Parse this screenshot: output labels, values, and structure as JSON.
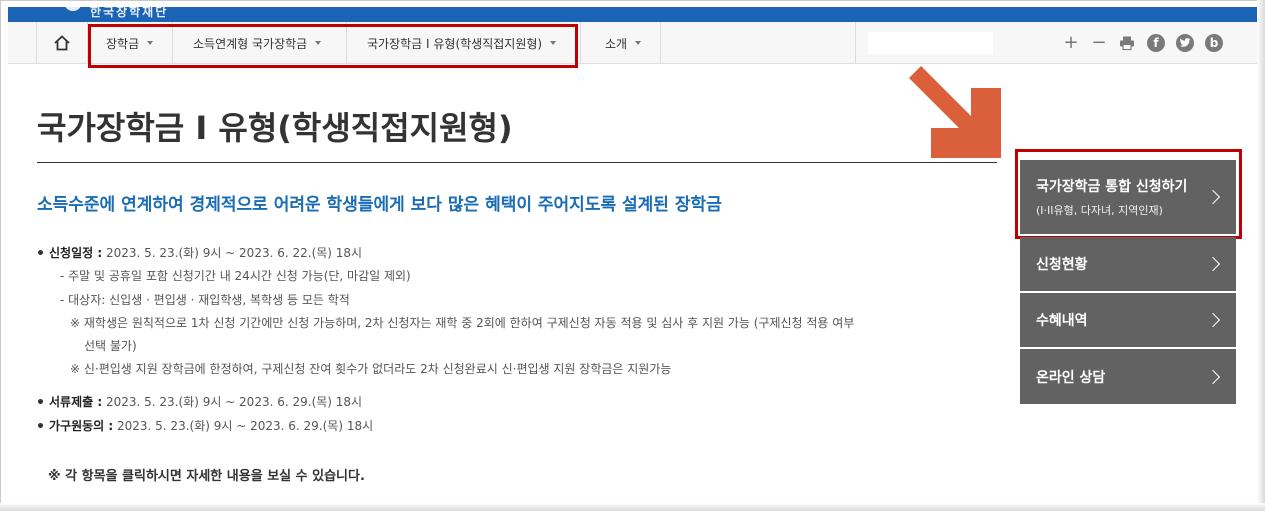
{
  "header": {
    "logo_text": "한국장학재단"
  },
  "nav": {
    "home_icon": "home-icon",
    "items": [
      {
        "label": "장학금"
      },
      {
        "label": "소득연계형 국가장학금"
      },
      {
        "label": "국가장학금 I 유형(학생직접지원형)"
      },
      {
        "label": "소개"
      }
    ],
    "tools": [
      "plus-icon",
      "minus-icon",
      "print-icon",
      "facebook-icon",
      "twitter-icon",
      "blog-icon"
    ],
    "tool_glyphs": {
      "plus": "+",
      "minus": "−",
      "facebook": "f",
      "blog": "b"
    }
  },
  "page": {
    "title": "국가장학금 I 유형(학생직접지원형)",
    "subtitle": "소득수준에 연계하여 경제적으로 어려운 학생들에게 보다 많은 혜택이 주어지도록 설계된 장학금",
    "schedule": {
      "label": "신청일정 :",
      "value": " 2023. 5. 23.(화) 9시 ~ 2023. 6. 22.(목) 18시",
      "sub1": "- 주말 및 공휴일 포함 신청기간 내 24시간 신청 가능(단, 마감일 제외)",
      "sub2": "- 대상자: 신입생 · 편입생 · 재입학생, 복학생 등 모든 학적",
      "note1_line1": "※ 재학생은 원칙적으로 1차 신청 기간에만 신청 가능하며, 2차 신청자는 재학 중 2회에 한하여 구제신청 자동 적용 및 심사 후 지원 가능 (구제신청 적용 여부",
      "note1_line2": "선택 불가)",
      "note2": "※ 신·편입생 지원 장학금에 한정하여, 구제신청 잔여 횟수가 없더라도 2차 신청완료시 신·편입생 지원 장학금은 지원가능"
    },
    "documents": {
      "label": "서류제출 :",
      "value": " 2023. 5. 23.(화) 9시 ~ 2023. 6. 29.(목) 18시"
    },
    "consent": {
      "label": "가구원동의 :",
      "value": " 2023. 5. 23.(화) 9시 ~ 2023. 6. 29.(목) 18시"
    },
    "note": "※ 각 항목을 클릭하시면 자세한 내용을 보실 수 있습니다."
  },
  "sidebar": {
    "apply": {
      "label": "국가장학금 통합 신청하기",
      "sub": "(I·II유형, 다자녀, 지역인재)"
    },
    "status": {
      "label": "신청현황"
    },
    "history": {
      "label": "수혜내역"
    },
    "consult": {
      "label": "온라인 상담"
    }
  },
  "colors": {
    "brand_blue": "#1b63b5",
    "subtitle_blue": "#1a6cb5",
    "highlight_red": "#c00000",
    "arrow_orange": "#d9603b",
    "sidebar_gray": "#626262"
  }
}
